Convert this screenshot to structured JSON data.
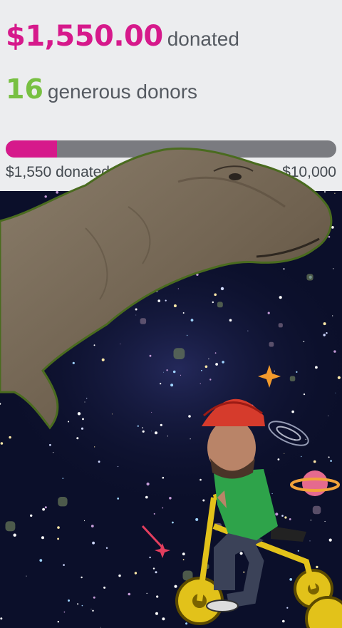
{
  "donation": {
    "amount": "$1,550.00",
    "amount_suffix": "donated",
    "donor_count": "16",
    "donor_suffix": "generous donors"
  },
  "progress": {
    "raised_label": "$1,550 donated",
    "goal_label": "$10,000",
    "fraction": 0.155
  },
  "colors": {
    "accent": "#d6198b",
    "donors": "#78c042",
    "track": "#7a7b80",
    "background": "#ecedef"
  }
}
